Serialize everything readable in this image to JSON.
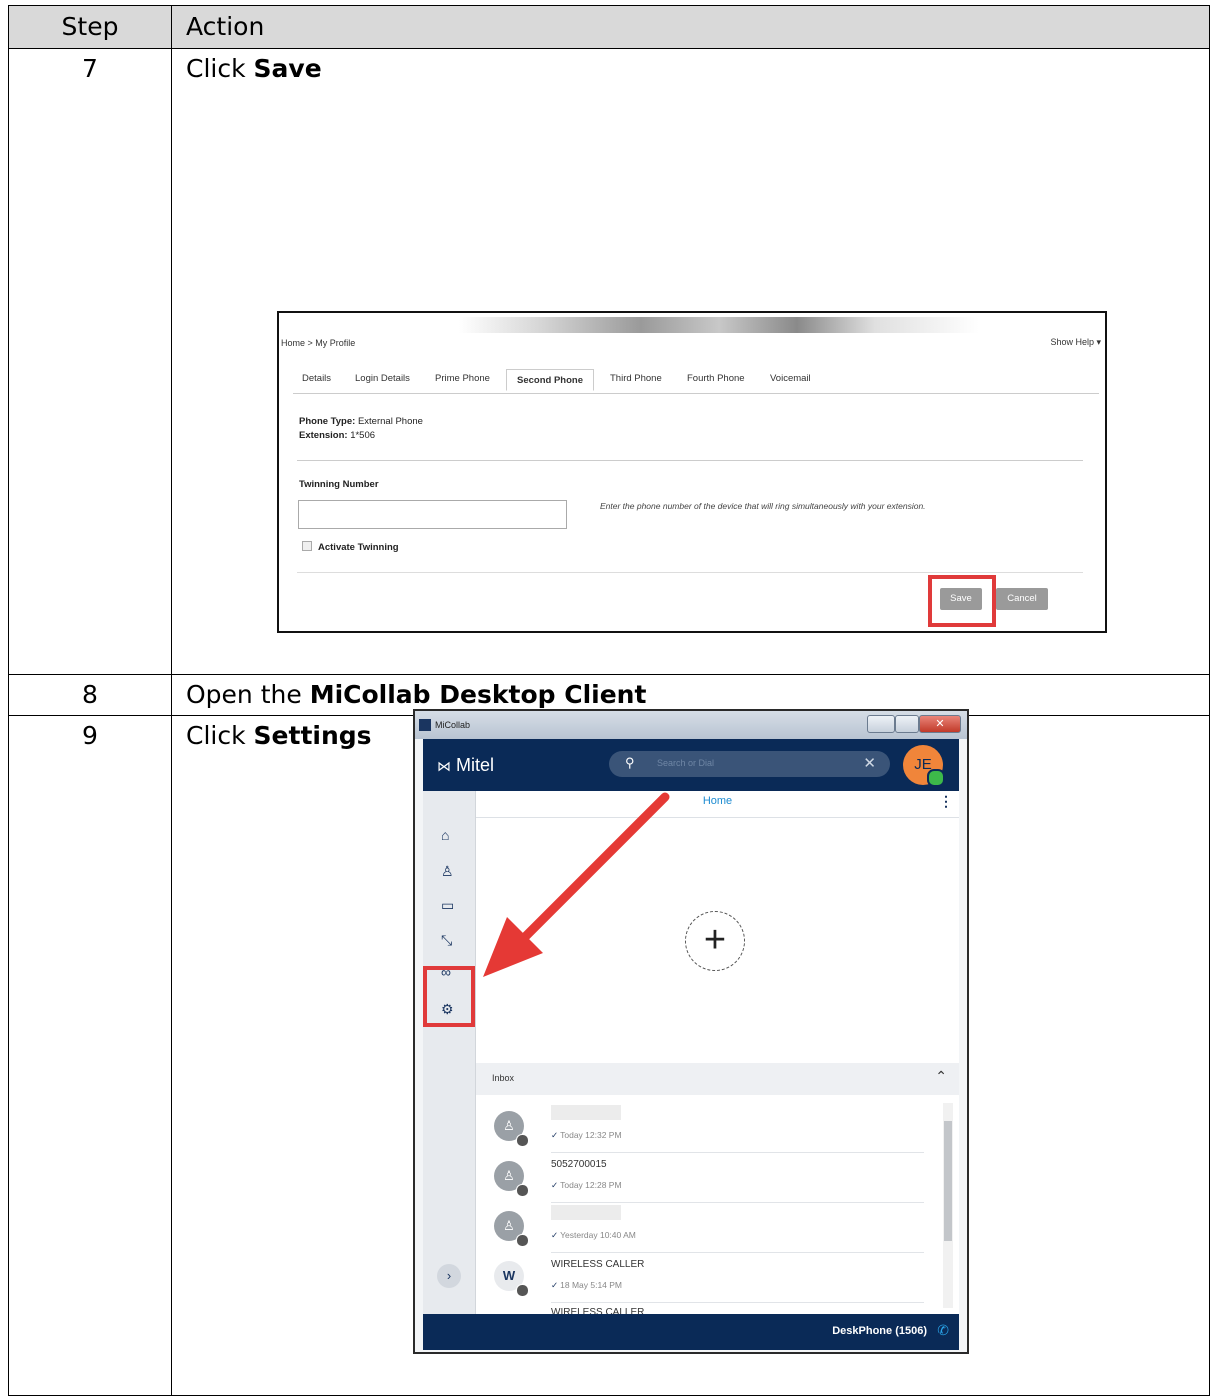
{
  "table": {
    "header": {
      "step": "Step",
      "action": "Action"
    },
    "rows": [
      {
        "step": "7",
        "prefix": "Click ",
        "bold": "Save"
      },
      {
        "step": "8",
        "prefix": "Open the ",
        "bold": "MiCollab Desktop Client"
      },
      {
        "step": "9",
        "prefix": "Click ",
        "bold": "Settings"
      }
    ]
  },
  "profile_page": {
    "breadcrumb": "Home  >  My Profile",
    "show_help": "Show Help ▾",
    "tabs": [
      "Details",
      "Login Details",
      "Prime Phone",
      "Second Phone",
      "Third Phone",
      "Fourth Phone",
      "Voicemail"
    ],
    "active_tab": "Second Phone",
    "phone_type_label": "Phone Type:",
    "phone_type_value": "External Phone",
    "extension_label": "Extension:",
    "extension_value": "1*506",
    "twinning_label": "Twinning Number",
    "twinning_value": "",
    "twinning_hint": "Enter the phone number of the device that will ring simultaneously with your extension.",
    "activate_label": "Activate Twinning",
    "activate_checked": false,
    "save_label": "Save",
    "cancel_label": "Cancel",
    "highlight_color": "#e03a3a"
  },
  "micollab": {
    "window_title": "MiCollab",
    "logo": "Mitel",
    "search_placeholder": "Search or Dial",
    "avatar_initials": "JE",
    "home_title": "Home",
    "sidebar_icons": [
      "home-icon",
      "contacts-icon",
      "chat-icon",
      "calls-icon",
      "voicemail-icon",
      "settings-icon"
    ],
    "inbox_label": "Inbox",
    "inbox_items": [
      {
        "name": "",
        "time": "Today 12:32 PM",
        "avatar": ""
      },
      {
        "name": "5052700015",
        "time": "Today 12:28 PM",
        "avatar": ""
      },
      {
        "name": "",
        "time": "Yesterday 10:40 AM",
        "avatar": ""
      },
      {
        "name": "WIRELESS CALLER",
        "time": "18 May 5:14 PM",
        "avatar": "W"
      },
      {
        "name": "WIRELESS CALLER",
        "time": "",
        "avatar": ""
      }
    ],
    "device": "DeskPhone (1506)",
    "header_color": "#0a2a57",
    "avatar_color": "#f0853a"
  }
}
